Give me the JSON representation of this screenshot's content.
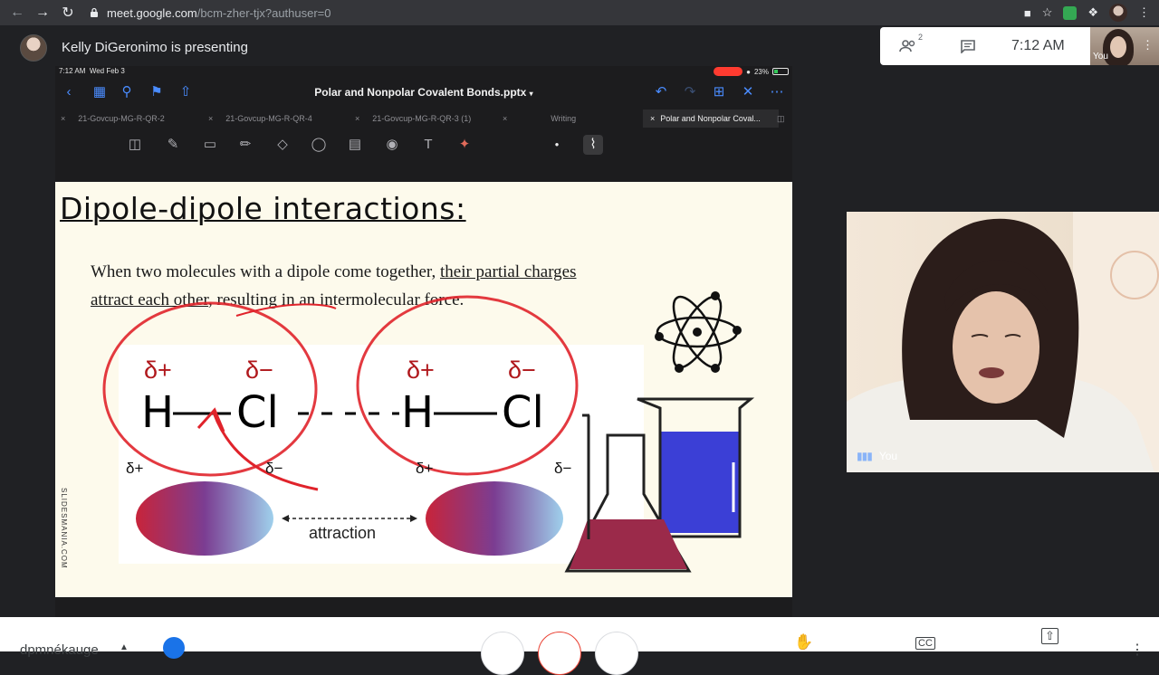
{
  "browser": {
    "url_host": "meet.google.com",
    "url_path": "/bcm-zher-tjx?authuser=0"
  },
  "meet": {
    "presenter_text": "Kelly DiGeronimo is presenting",
    "people_badge": "2",
    "time": "7:12 AM",
    "self_label": "You",
    "meeting_code": "dpmnékauge",
    "cam_label": "You"
  },
  "ipad": {
    "time": "7:12 AM",
    "date": "Wed Feb 3",
    "battery": "23%",
    "doc_title": "Polar and Nonpolar Covalent Bonds.pptx",
    "tabs": [
      {
        "label": "21-Govcup-MG-R-QR-2"
      },
      {
        "label": "21-Govcup-MG-R-QR-4"
      },
      {
        "label": "21-Govcup-MG-R-QR-3 (1)"
      },
      {
        "label": "Writing"
      },
      {
        "label": "Polar and Nonpolar Coval..."
      }
    ]
  },
  "slide": {
    "title": "Dipole-dipole interactions:",
    "body_plain": "When two molecules with a dipole come together, ",
    "body_ul1": "their partial charges",
    "body_ul2": "attract each other",
    "body_tail": ", resulting in an intermolecular force.",
    "watermark": "SLIDESMANIA.COM",
    "delta_plus": "δ+",
    "delta_minus": "δ−",
    "h": "H",
    "cl": "Cl",
    "attraction": "attraction"
  },
  "colors": {
    "accent_blue": "#4a8cff",
    "delta_red": "#b0181c",
    "annotation_red": "#e0232b",
    "beaker_blue": "#3b3fd6",
    "flask_maroon": "#9b2a4a"
  }
}
